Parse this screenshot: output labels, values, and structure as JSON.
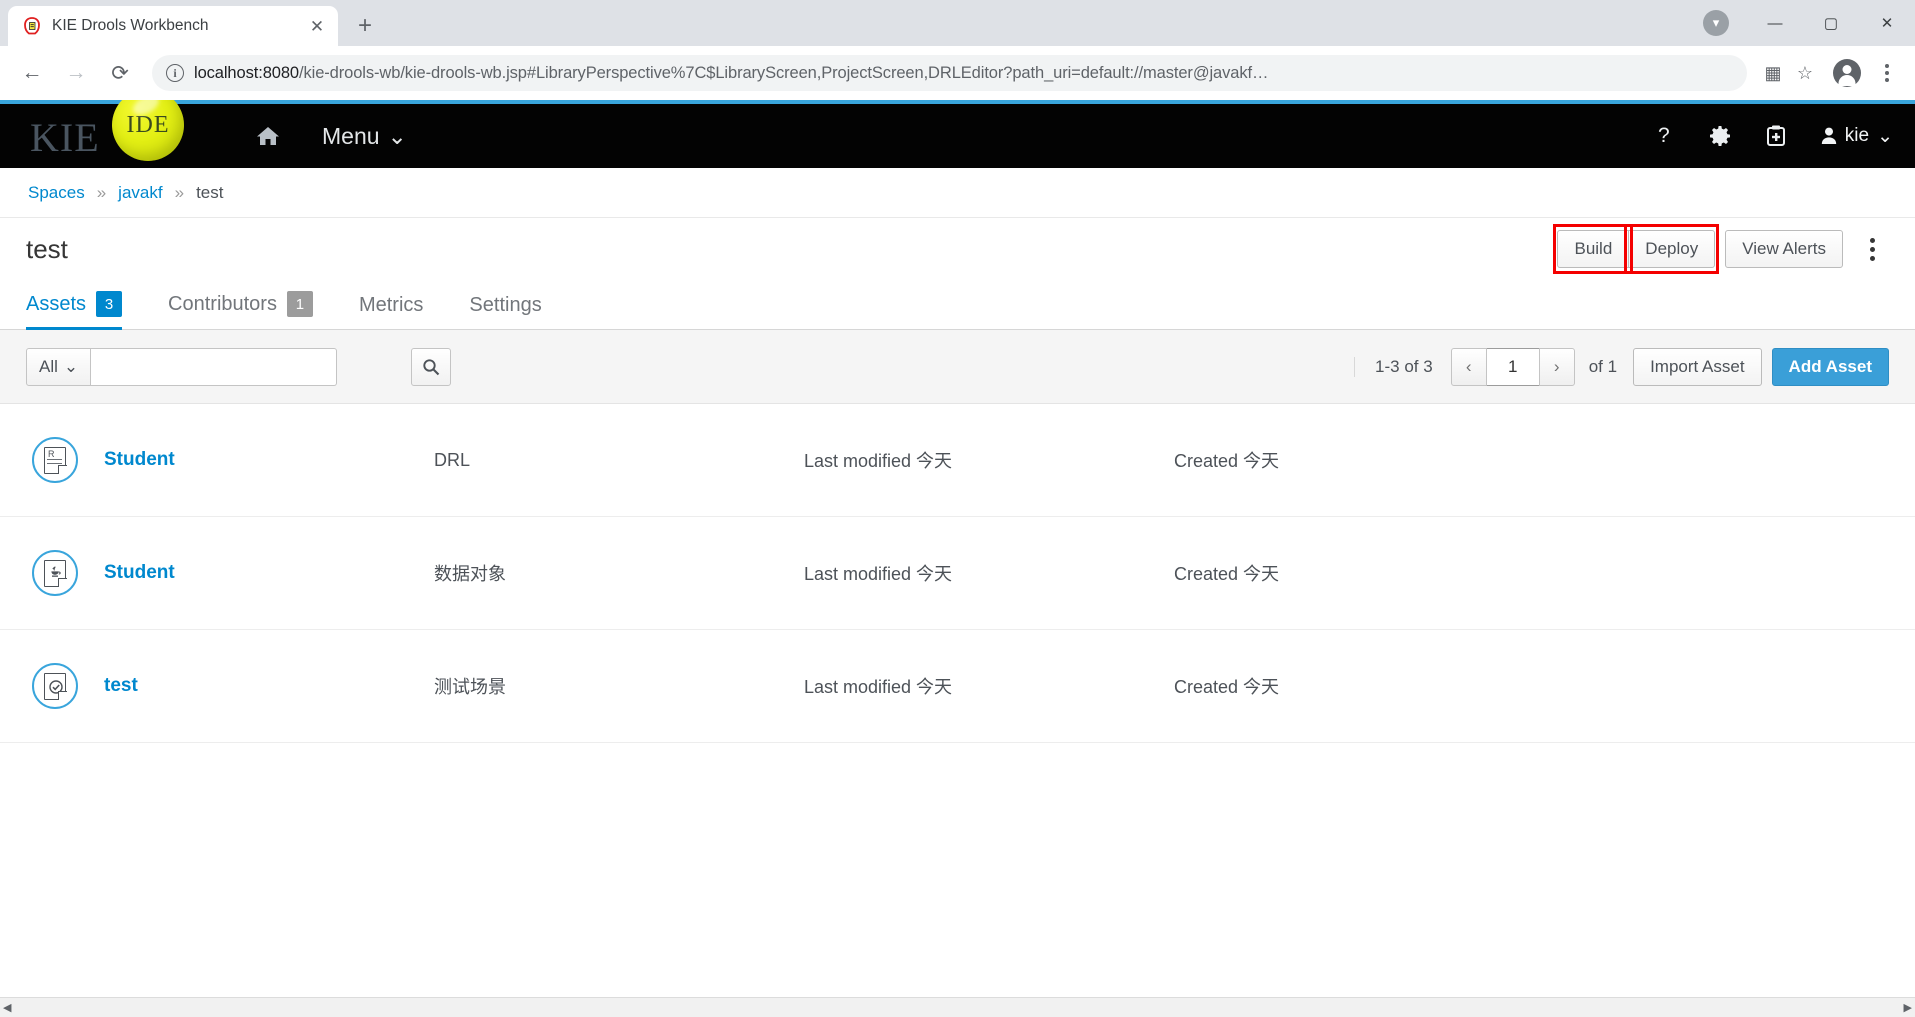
{
  "browser": {
    "tab": {
      "title": "KIE Drools Workbench",
      "favicon": "kie-favicon",
      "close_label": "✕"
    },
    "new_tab_label": "+",
    "nav": {
      "back": "←",
      "forward": "→",
      "reload": "⟳"
    },
    "omnibox": {
      "host": "localhost:8080",
      "path": "/kie-drools-wb/kie-drools-wb.jsp#LibraryPerspective%7C$LibraryScreen,ProjectScreen,DRLEditor?path_uri=default://master@javakf…",
      "info_icon": "ⓘ",
      "qr_icon": "▦",
      "bookmark_icon": "☆"
    },
    "window": {
      "minimize": "—",
      "maximize": "▢",
      "close": "✕",
      "update_badge": "▾"
    }
  },
  "kie_header": {
    "logo_text": "KIE",
    "logo_ball_text": "IDE",
    "home_icon": "home-icon",
    "menu_label": "Menu",
    "menu_caret": "⌄",
    "help_icon": "?",
    "gear_icon": "✱",
    "kit_icon": "kit-icon",
    "user_name": "kie",
    "user_caret": "⌄"
  },
  "breadcrumb": {
    "items": [
      {
        "label": "Spaces",
        "link": true
      },
      {
        "label": "javakf",
        "link": true
      },
      {
        "label": "test",
        "link": false
      }
    ],
    "separator": "»"
  },
  "project": {
    "title": "test",
    "actions": {
      "build": "Build",
      "deploy": "Deploy",
      "view_alerts": "View Alerts",
      "overflow": "kebab-menu"
    },
    "annotations": {
      "color": "#f40000",
      "targets": [
        "Build",
        "Deploy"
      ]
    }
  },
  "tabs": [
    {
      "label": "Assets",
      "badge": "3",
      "active": true
    },
    {
      "label": "Contributors",
      "badge": "1",
      "active": false
    },
    {
      "label": "Metrics",
      "badge": "",
      "active": false
    },
    {
      "label": "Settings",
      "badge": "",
      "active": false
    }
  ],
  "toolbar": {
    "filter_label": "All",
    "filter_caret": "⌄",
    "search_value": "",
    "search_placeholder": "",
    "search_icon": "search-icon",
    "range_text": "1-3 of 3",
    "prev_icon": "‹",
    "page_value": "1",
    "next_icon": "›",
    "of_text": "of 1",
    "import_asset": "Import Asset",
    "add_asset": "Add Asset"
  },
  "assets": [
    {
      "icon": "drl-file-icon",
      "name": "Student",
      "type": "DRL",
      "modified": "Last modified 今天",
      "created": "Created 今天"
    },
    {
      "icon": "java-data-object-icon",
      "name": "Student",
      "type": "数据对象",
      "modified": "Last modified 今天",
      "created": "Created 今天"
    },
    {
      "icon": "test-scenario-icon",
      "name": "test",
      "type": "测试场景",
      "modified": "Last modified 今天",
      "created": "Created 今天"
    }
  ],
  "colors": {
    "accent_blue": "#0088ce",
    "topbar_stripe": "#39a5dc",
    "annotation_red": "#f40000",
    "ide_ball_yellow": "#e3ef14"
  },
  "scrollbar": {
    "left_arrow": "◀",
    "right_arrow": "▶"
  }
}
